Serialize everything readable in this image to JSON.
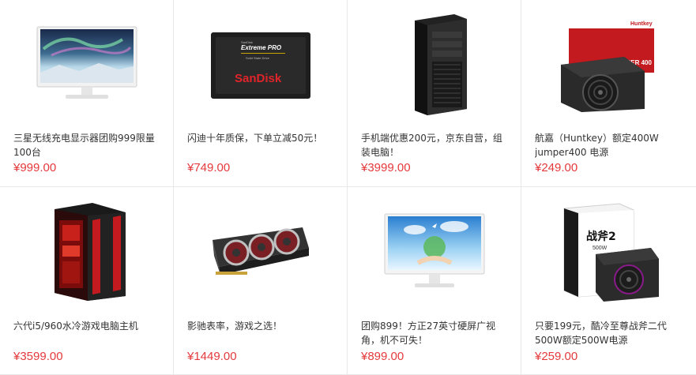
{
  "currency_symbol": "¥",
  "colors": {
    "price": "#e4393c",
    "title": "#333333",
    "divider": "#e8e8e8"
  },
  "products": [
    {
      "title": "三星无线充电显示器团购999限量100台",
      "price": "¥999.00",
      "image": "monitor-icon"
    },
    {
      "title": "闪迪十年质保，下单立减50元！",
      "price": "¥749.00",
      "image": "ssd-icon",
      "image_text": {
        "line1": "SanDisk",
        "line2": "Extreme PRO",
        "line3": "Solid State Drive",
        "brand": "SanDisk"
      }
    },
    {
      "title": "手机端优惠200元，京东自营，组装电脑！",
      "price": "¥3999.00",
      "image": "pc-case-icon"
    },
    {
      "title": "航嘉（Huntkey）额定400W jumper400 电源",
      "price": "¥249.00",
      "image": "power-supply-icon",
      "image_text": {
        "brand": "Huntkey",
        "model": "JUMPER 400"
      }
    },
    {
      "title": "六代i5/960水冷游戏电脑主机",
      "price": "¥3599.00",
      "image": "gaming-pc-icon"
    },
    {
      "title": "影驰表率，游戏之选！",
      "price": "¥1449.00",
      "image": "graphics-card-icon"
    },
    {
      "title": "团购899！方正27英寸硬屏广视角，机不可失！",
      "price": "¥899.00",
      "image": "monitor-icon"
    },
    {
      "title": "只要199元，酷冷至尊战斧二代500W额定500W电源",
      "price": "¥259.00",
      "image": "power-supply-icon",
      "image_text": {
        "name": "战斧2",
        "watt": "500W"
      }
    }
  ]
}
